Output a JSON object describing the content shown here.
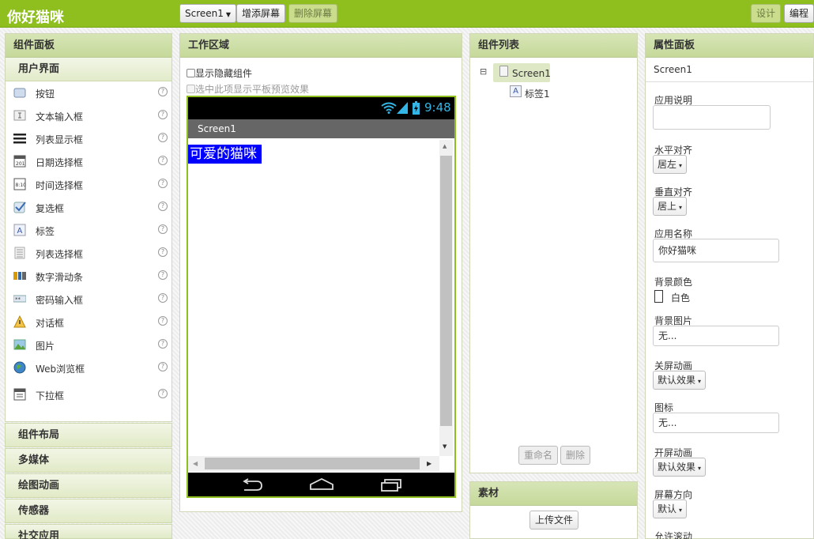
{
  "app_title": "你好猫咪",
  "toolbar": {
    "screen_select": "Screen1",
    "add_screen": "增添屏幕",
    "remove_screen": "删除屏幕",
    "designer": "设计",
    "blocks": "编程"
  },
  "palette": {
    "title": "组件面板",
    "section": "用户界面",
    "items": [
      {
        "label": "按钮",
        "icon": "button-icon",
        "help": "?"
      },
      {
        "label": "文本输入框",
        "icon": "textbox-icon",
        "help": "?"
      },
      {
        "label": "列表显示框",
        "icon": "listview-icon",
        "help": "?"
      },
      {
        "label": "日期选择框",
        "icon": "datepicker-icon",
        "help": "?"
      },
      {
        "label": "时间选择框",
        "icon": "timepicker-icon",
        "help": "?"
      },
      {
        "label": "复选框",
        "icon": "checkbox-icon",
        "help": "?"
      },
      {
        "label": "标签",
        "icon": "label-icon",
        "help": "?"
      },
      {
        "label": "列表选择框",
        "icon": "listpicker-icon",
        "help": "?"
      },
      {
        "label": "数字滑动条",
        "icon": "slider-icon",
        "help": "?"
      },
      {
        "label": "密码输入框",
        "icon": "password-icon",
        "help": "?"
      },
      {
        "label": "对话框",
        "icon": "notifier-icon",
        "help": "?"
      },
      {
        "label": "图片",
        "icon": "image-icon",
        "help": "?"
      },
      {
        "label": "Web浏览框",
        "icon": "webviewer-icon",
        "help": "?"
      },
      {
        "label": "下拉框",
        "icon": "spinner-icon",
        "help": "?"
      }
    ],
    "categories": [
      "组件布局",
      "多媒体",
      "绘图动画",
      "传感器",
      "社交应用"
    ]
  },
  "viewer": {
    "title": "工作区域",
    "show_hidden": "显示隐藏组件",
    "tablet_preview": "选中此项显示平板预览效果",
    "status_time": "9:48",
    "screen_title": "Screen1",
    "label_text": "可爱的猫咪"
  },
  "components": {
    "title": "组件列表",
    "tree": [
      {
        "label": "Screen1"
      },
      {
        "label": "标签1"
      }
    ],
    "rename": "重命名",
    "delete": "删除",
    "expander": "⊟"
  },
  "media": {
    "title": "素材",
    "upload": "上传文件"
  },
  "properties": {
    "title": "属性面板",
    "component": "Screen1",
    "about_label": "应用说明",
    "about_value": "",
    "align_h_label": "水平对齐",
    "align_h_value": "居左",
    "align_v_label": "垂直对齐",
    "align_v_value": "居上",
    "app_name_label": "应用名称",
    "app_name_value": "你好猫咪",
    "bg_color_label": "背景颜色",
    "bg_color_value": "白色",
    "bg_image_label": "背景图片",
    "bg_image_value": "无...",
    "close_anim_label": "关屏动画",
    "close_anim_value": "默认效果",
    "icon_label": "图标",
    "icon_value": "无...",
    "open_anim_label": "开屏动画",
    "open_anim_value": "默认效果",
    "orientation_label": "屏幕方向",
    "orientation_value": "默认",
    "scrollable_label": "允许滚动"
  },
  "colors": {
    "brand": "#8fbf1f",
    "label_bg": "#0000ff"
  }
}
